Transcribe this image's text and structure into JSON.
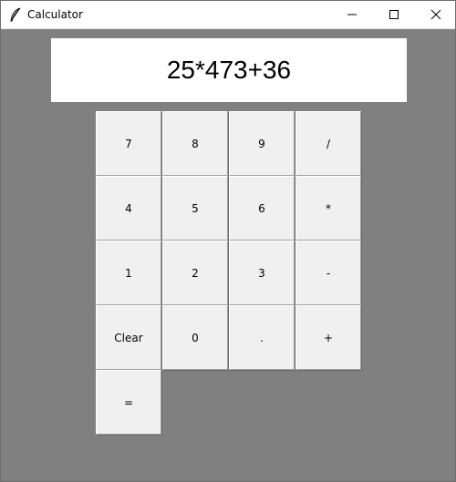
{
  "window": {
    "title": "Calculator",
    "controls": [
      "minimize",
      "maximize",
      "close"
    ]
  },
  "display": {
    "value": "25*473+36"
  },
  "keypad": {
    "rows": [
      [
        "7",
        "8",
        "9",
        "/"
      ],
      [
        "4",
        "5",
        "6",
        "*"
      ],
      [
        "1",
        "2",
        "3",
        "-"
      ],
      [
        "Clear",
        "0",
        ".",
        "+"
      ],
      [
        "="
      ]
    ]
  },
  "colors": {
    "background": "#808080",
    "display_background": "#ffffff",
    "button_face": "#f0f0f0"
  },
  "icons": {
    "app": "feather-icon",
    "minimize": "minimize-icon",
    "maximize": "maximize-icon",
    "close": "close-icon"
  }
}
